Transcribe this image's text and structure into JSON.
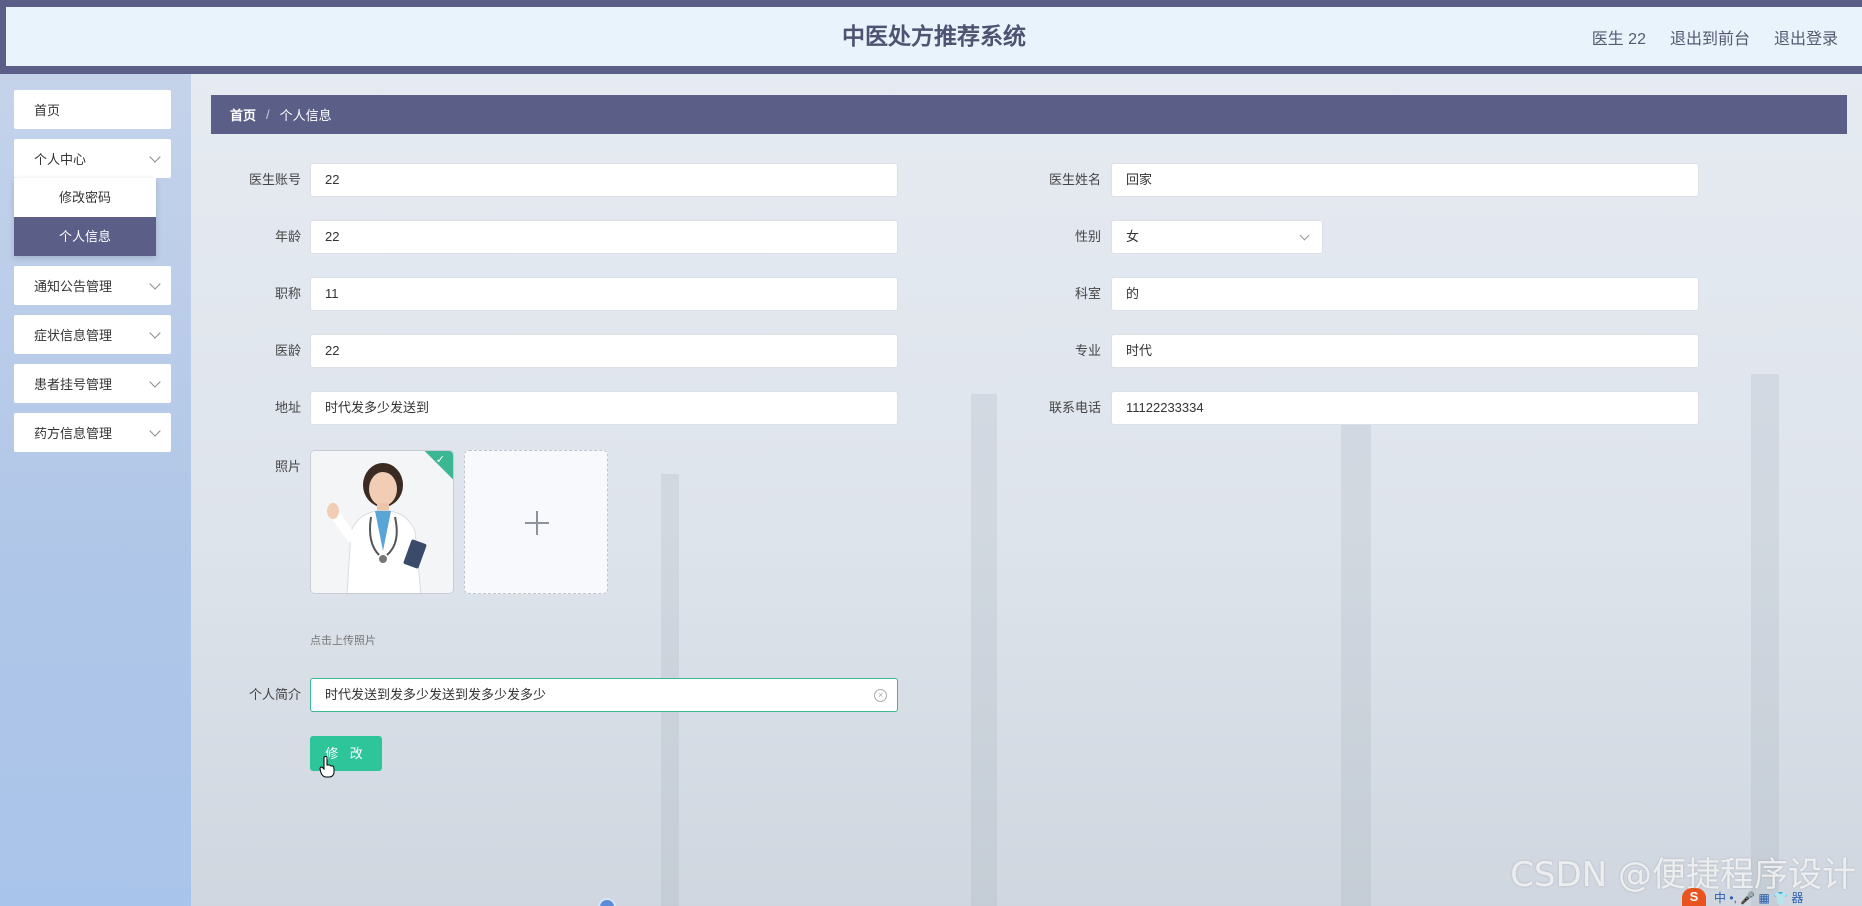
{
  "header": {
    "title": "中医处方推荐系统",
    "user": "医生 22",
    "back_to_front": "退出到前台",
    "logout": "退出登录"
  },
  "sidebar": {
    "items": [
      {
        "label": "首页"
      },
      {
        "label": "个人中心",
        "expanded": true
      },
      {
        "label": "通知公告管理"
      },
      {
        "label": "症状信息管理"
      },
      {
        "label": "患者挂号管理"
      },
      {
        "label": "药方信息管理"
      }
    ],
    "submenu": [
      {
        "label": "修改密码"
      },
      {
        "label": "个人信息",
        "active": true
      }
    ]
  },
  "breadcrumb": {
    "home": "首页",
    "separator": "/",
    "current": "个人信息"
  },
  "form": {
    "account": {
      "label": "医生账号",
      "value": "22"
    },
    "name": {
      "label": "医生姓名",
      "value": "回家"
    },
    "age": {
      "label": "年龄",
      "value": "22"
    },
    "gender": {
      "label": "性别",
      "value": "女"
    },
    "title": {
      "label": "职称",
      "value": "11"
    },
    "department": {
      "label": "科室",
      "value": "的"
    },
    "years": {
      "label": "医龄",
      "value": "22"
    },
    "major": {
      "label": "专业",
      "value": "时代"
    },
    "address": {
      "label": "地址",
      "value": "时代发多少发送到"
    },
    "phone": {
      "label": "联系电话",
      "value": "11122233334"
    },
    "photo": {
      "label": "照片",
      "hint": "点击上传照片"
    },
    "intro": {
      "label": "个人简介",
      "value": "时代发送到发多少发送到发多少发多少"
    },
    "submit_label": "修 改"
  },
  "watermark": "CSDN @便捷程序设计",
  "ime": {
    "s": "S",
    "glyphs": "中 •, 🎤 ▦ 👕 器"
  },
  "colors": {
    "primary": "#5b5f88",
    "header_bg": "#e8f3fb",
    "accent": "#2ec59b",
    "sidebar_bg": "#afc6e8"
  }
}
